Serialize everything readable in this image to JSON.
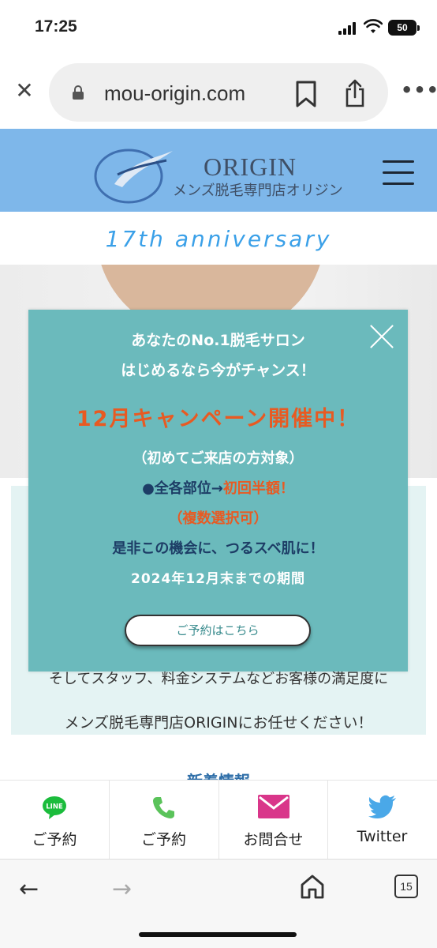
{
  "status_bar": {
    "time": "17:25",
    "battery": "50"
  },
  "browser": {
    "url": "mou-origin.com",
    "tabs_count": "15"
  },
  "site": {
    "logo_name": "ORIGIN",
    "logo_sub": "メンズ脱毛専門店オリジン",
    "anniversary": "17th anniversary",
    "brand_color": "#7eb7ea"
  },
  "content": {
    "line1": "そしてスタッフ、料金システムなどお客様の満足度に",
    "line2": "メンズ脱毛専門店ORIGINにお任せください！",
    "news_title": "新着情報"
  },
  "popup": {
    "line1": "あなたのNo.1脱毛サロン",
    "line2": "はじめるなら今がチャンス！",
    "campaign": "12月キャンペーン開催中！",
    "target": "（初めてご来店の方対象）",
    "offer_prefix": "●全各部位→",
    "offer_highlight": "初回半額！",
    "multi": "（複数選択可）",
    "slogan": "是非この機会に、つるスベ肌に！",
    "period": "2024年12月末までの期間",
    "button": "ご予約はこちら",
    "bg_color": "#6bbabc",
    "accent_color": "#e85a22"
  },
  "bottom_nav": [
    {
      "label": "ご予約",
      "icon": "line-icon"
    },
    {
      "label": "ご予約",
      "icon": "phone-icon"
    },
    {
      "label": "お問合せ",
      "icon": "mail-icon"
    },
    {
      "label": "Twitter",
      "icon": "twitter-icon"
    }
  ],
  "icons": {
    "line_badge": "LINE"
  }
}
